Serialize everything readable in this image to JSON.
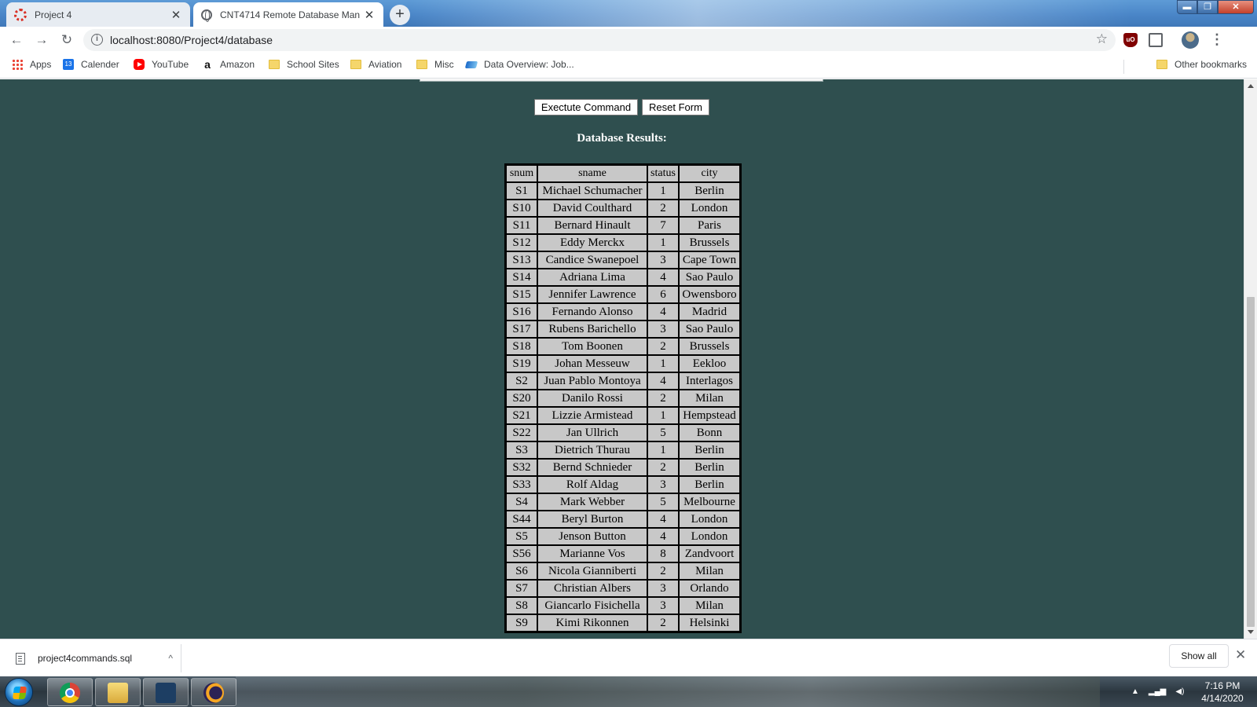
{
  "browser": {
    "tabs": [
      {
        "title": "Project 4",
        "close": "✕"
      },
      {
        "title": "CNT4714 Remote Database Man",
        "close": "✕"
      }
    ],
    "new_tab": "+",
    "url": "localhost:8080/Project4/database",
    "nav": {
      "back": "←",
      "forward": "→",
      "reload": "↻"
    },
    "star": "☆",
    "menu": "⋮",
    "window_controls": {
      "minimize": "▬",
      "maximize": "❐",
      "close": "✕"
    }
  },
  "bookmarks": {
    "items": [
      {
        "label": "Apps",
        "icon": "apps-icon"
      },
      {
        "label": "Calender",
        "icon": "calendar-icon"
      },
      {
        "label": "YouTube",
        "icon": "youtube-icon"
      },
      {
        "label": "Amazon",
        "icon": "amazon-icon"
      },
      {
        "label": "School Sites",
        "icon": "folder-icon"
      },
      {
        "label": "Aviation",
        "icon": "folder-icon"
      },
      {
        "label": "Misc",
        "icon": "folder-icon"
      },
      {
        "label": "Data Overview: Job...",
        "icon": "sap-icon"
      }
    ],
    "other": "Other bookmarks"
  },
  "page": {
    "execute_button": "Exectute Command",
    "reset_button": "Reset Form",
    "results_title": "Database Results:",
    "table": {
      "headers": [
        "snum",
        "sname",
        "status",
        "city"
      ],
      "rows": [
        [
          "S1",
          "Michael Schumacher",
          "1",
          "Berlin"
        ],
        [
          "S10",
          "David Coulthard",
          "2",
          "London"
        ],
        [
          "S11",
          "Bernard Hinault",
          "7",
          "Paris"
        ],
        [
          "S12",
          "Eddy Merckx",
          "1",
          "Brussels"
        ],
        [
          "S13",
          "Candice Swanepoel",
          "3",
          "Cape Town"
        ],
        [
          "S14",
          "Adriana Lima",
          "4",
          "Sao Paulo"
        ],
        [
          "S15",
          "Jennifer Lawrence",
          "6",
          "Owensboro"
        ],
        [
          "S16",
          "Fernando Alonso",
          "4",
          "Madrid"
        ],
        [
          "S17",
          "Rubens Barichello",
          "3",
          "Sao Paulo"
        ],
        [
          "S18",
          "Tom Boonen",
          "2",
          "Brussels"
        ],
        [
          "S19",
          "Johan Messeuw",
          "1",
          "Eekloo"
        ],
        [
          "S2",
          "Juan Pablo Montoya",
          "4",
          "Interlagos"
        ],
        [
          "S20",
          "Danilo Rossi",
          "2",
          "Milan"
        ],
        [
          "S21",
          "Lizzie Armistead",
          "1",
          "Hempstead"
        ],
        [
          "S22",
          "Jan Ullrich",
          "5",
          "Bonn"
        ],
        [
          "S3",
          "Dietrich Thurau",
          "1",
          "Berlin"
        ],
        [
          "S32",
          "Bernd Schnieder",
          "2",
          "Berlin"
        ],
        [
          "S33",
          "Rolf Aldag",
          "3",
          "Berlin"
        ],
        [
          "S4",
          "Mark Webber",
          "5",
          "Melbourne"
        ],
        [
          "S44",
          "Beryl Burton",
          "4",
          "London"
        ],
        [
          "S5",
          "Jenson Button",
          "4",
          "London"
        ],
        [
          "S56",
          "Marianne Vos",
          "8",
          "Zandvoort"
        ],
        [
          "S6",
          "Nicola Gianniberti",
          "2",
          "Milan"
        ],
        [
          "S7",
          "Christian Albers",
          "3",
          "Orlando"
        ],
        [
          "S8",
          "Giancarlo Fisichella",
          "3",
          "Milan"
        ],
        [
          "S9",
          "Kimi Rikonnen",
          "2",
          "Helsinki"
        ]
      ]
    },
    "background_color": "#2f4f4f"
  },
  "download_shelf": {
    "filename": "project4commands.sql",
    "caret": "^",
    "show_all": "Show all",
    "close": "✕"
  },
  "taskbar": {
    "apps": [
      "chrome-icon",
      "file-explorer-icon",
      "mysql-workbench-icon",
      "eclipse-icon"
    ],
    "time": "7:16 PM",
    "date": "4/14/2020"
  }
}
